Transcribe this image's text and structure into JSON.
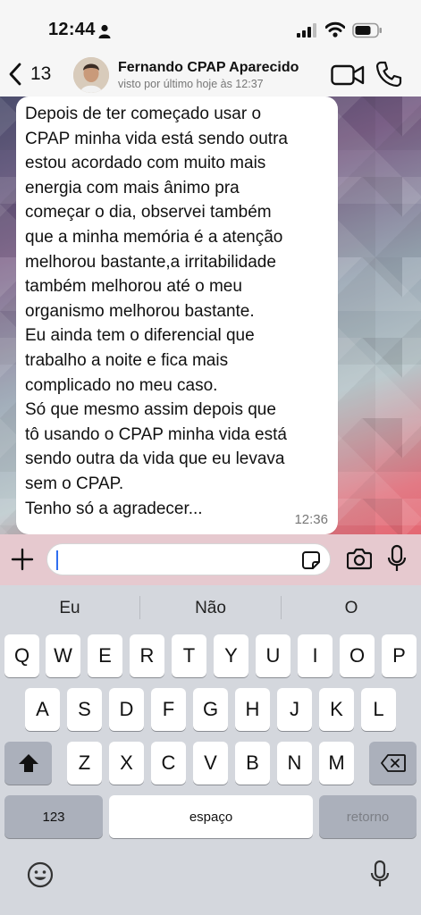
{
  "status_bar": {
    "time": "12:44"
  },
  "header": {
    "back_count": "13",
    "contact_name": "Fernando CPAP Aparecido",
    "last_seen": "visto por último hoje às 12:37"
  },
  "message": {
    "text": "Depois de ter começado usar o\nCPAP minha vida está sendo outra\nestou acordado com muito mais\nenergia com mais ânimo pra\ncomeçar o dia, observei também\nque a minha memória é a atenção\nmelhorou bastante,a irritabilidade\ntambém melhorou até o meu\norganismo melhorou bastante.\nEu ainda tem o diferencial que\ntrabalho a noite e fica mais\ncomplicado no meu caso.\nSó que mesmo assim depois que\ntô usando o CPAP minha vida está\nsendo outra da vida que eu levava\nsem o CPAP.\nTenho só a agradecer...",
    "time": "12:36"
  },
  "keyboard": {
    "suggestions": [
      "Eu",
      "Não",
      "O"
    ],
    "row1": [
      "Q",
      "W",
      "E",
      "R",
      "T",
      "Y",
      "U",
      "I",
      "O",
      "P"
    ],
    "row2": [
      "A",
      "S",
      "D",
      "F",
      "G",
      "H",
      "J",
      "K",
      "L"
    ],
    "row3": [
      "Z",
      "X",
      "C",
      "V",
      "B",
      "N",
      "M"
    ],
    "numbers_key": "123",
    "space_key": "espaço",
    "return_key": "retorno"
  },
  "colors": {
    "accent_cursor": "#2f6ef0",
    "bubble": "#ffffff"
  }
}
